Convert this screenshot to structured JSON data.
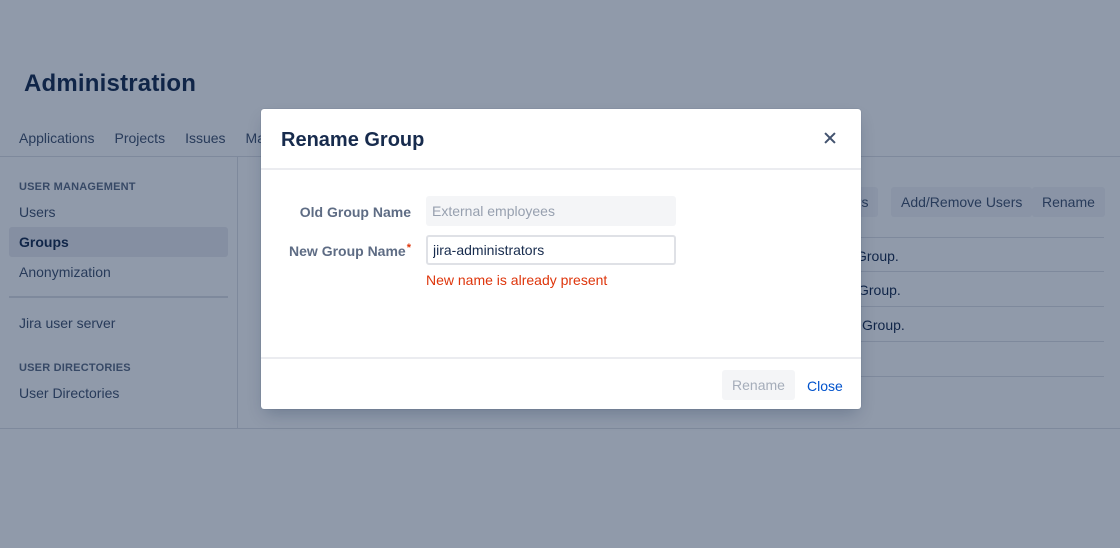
{
  "page": {
    "title": "Administration",
    "tabs": [
      "Applications",
      "Projects",
      "Issues",
      "Ma"
    ]
  },
  "sidebar": {
    "sections": [
      {
        "heading": "USER MANAGEMENT",
        "items": [
          "Users",
          "Groups",
          "Anonymization"
        ]
      },
      {
        "heading": "",
        "items": [
          "Jira user server"
        ]
      },
      {
        "heading": "USER DIRECTORIES",
        "items": [
          "User Directories"
        ]
      }
    ],
    "active_item": "Groups"
  },
  "content": {
    "buttons": [
      "ers",
      "Add/Remove Users",
      "Rename"
    ],
    "rows": [
      "Group.",
      "Group.",
      "is Group.",
      ""
    ]
  },
  "dialog": {
    "title": "Rename Group",
    "old_label": "Old Group Name",
    "old_value": "External employees",
    "new_label": "New Group Name",
    "required_mark": "*",
    "new_value": "jira-administrators",
    "error": "New name is already present",
    "rename_button": "Rename",
    "close_button": "Close"
  },
  "colors": {
    "blanket": "#091e42",
    "error": "#de350b",
    "link": "#0052cc",
    "text": "#172b4d"
  },
  "icons": {
    "close": "close-icon"
  }
}
